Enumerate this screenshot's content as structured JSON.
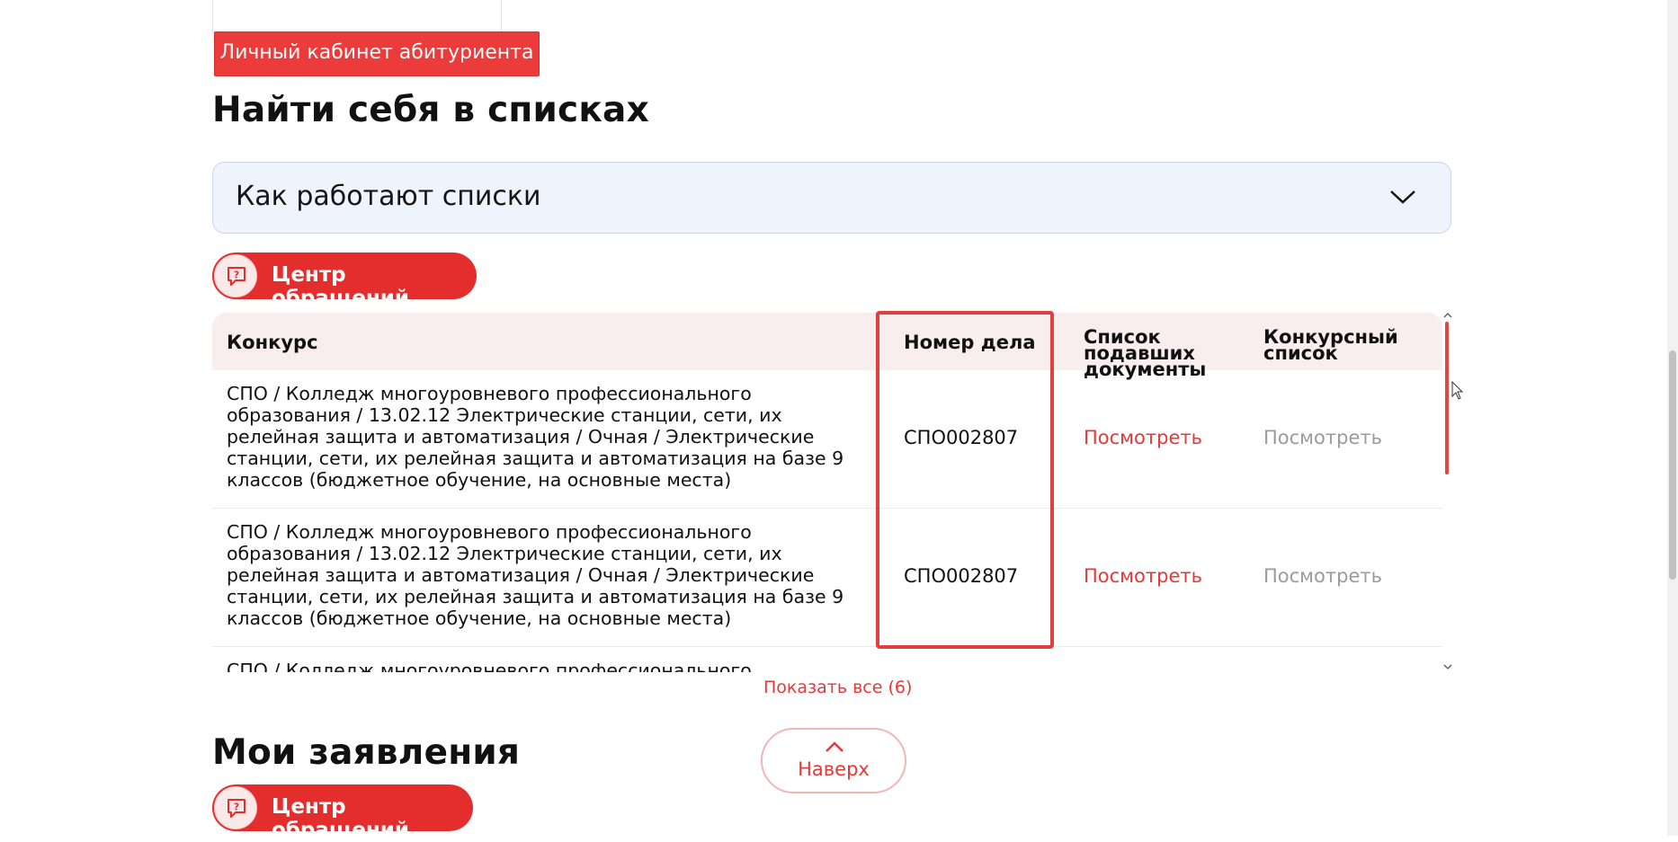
{
  "top_button": "Личный кабинет абитуриента",
  "section_title": "Найти себя в списках",
  "accordion": {
    "title": "Как работают списки",
    "icon": "chevron-down-icon"
  },
  "appeal_button": {
    "label": "Центр обращений",
    "icon": "question-chat-icon"
  },
  "table": {
    "headers": {
      "competition": "Конкурс",
      "case_number": "Номер дела",
      "submitted_list": "Список подавших документы",
      "competitive_list": "Конкурсный список"
    },
    "rows": [
      {
        "competition": "СПО / Колледж многоуровневого профессионального образования / 13.02.12 Электрические станции, сети, их релейная защита и автоматизация / Очная / Электрические станции, сети, их релейная защита и автоматизация на базе 9 классов (бюджетное обучение, на основные места)",
        "case_number": "СПО002807",
        "submitted_list": "Посмотреть",
        "competitive_list": "Посмотреть"
      },
      {
        "competition": "СПО / Колледж многоуровневого профессионального образования / 13.02.12 Электрические станции, сети, их релейная защита и автоматизация / Очная / Электрические станции, сети, их релейная защита и автоматизация на базе 9 классов (бюджетное обучение, на основные места)",
        "case_number": "СПО002807",
        "submitted_list": "Посмотреть",
        "competitive_list": "Посмотреть"
      },
      {
        "competition": "СПО / Колледж многоуровневого профессионального образования /",
        "case_number": "",
        "submitted_list": "",
        "competitive_list": ""
      }
    ]
  },
  "show_all": "Показать все (6)",
  "to_top": "Наверх",
  "applications_title": "Мои заявления",
  "appeal_button_2": {
    "label": "Центр обращений"
  },
  "colors": {
    "accent": "#e42e2e",
    "accordion_bg": "#eef3fc",
    "table_header_bg": "#f9eeee",
    "muted_link": "#9b9b9b"
  }
}
